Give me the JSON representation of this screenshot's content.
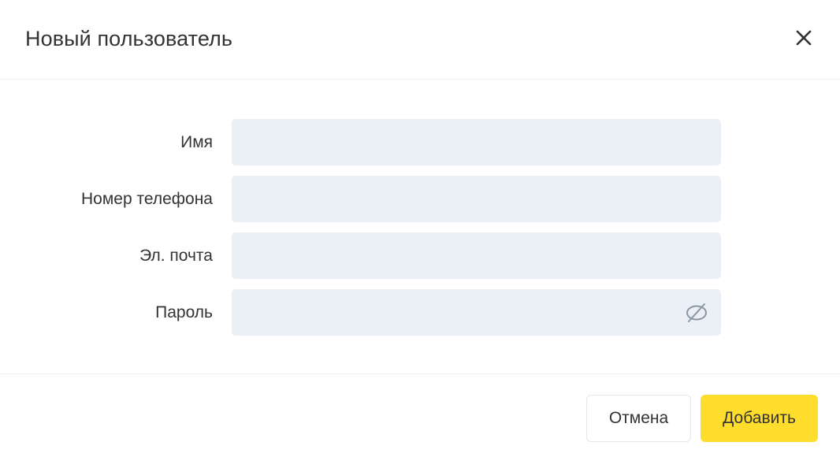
{
  "dialog": {
    "title": "Новый пользователь",
    "close_icon": "close-icon"
  },
  "form": {
    "fields": [
      {
        "label": "Имя",
        "value": "",
        "placeholder": ""
      },
      {
        "label": "Номер телефона",
        "value": "",
        "placeholder": ""
      },
      {
        "label": "Эл. почта",
        "value": "",
        "placeholder": ""
      },
      {
        "label": "Пароль",
        "value": "",
        "placeholder": "",
        "toggle_icon": "eye-off-icon"
      }
    ]
  },
  "footer": {
    "cancel_label": "Отмена",
    "submit_label": "Добавить"
  },
  "colors": {
    "input_background": "#ebf0f6",
    "primary_button": "#ffdd2d",
    "text": "#333333",
    "divider": "#eef0f3"
  }
}
